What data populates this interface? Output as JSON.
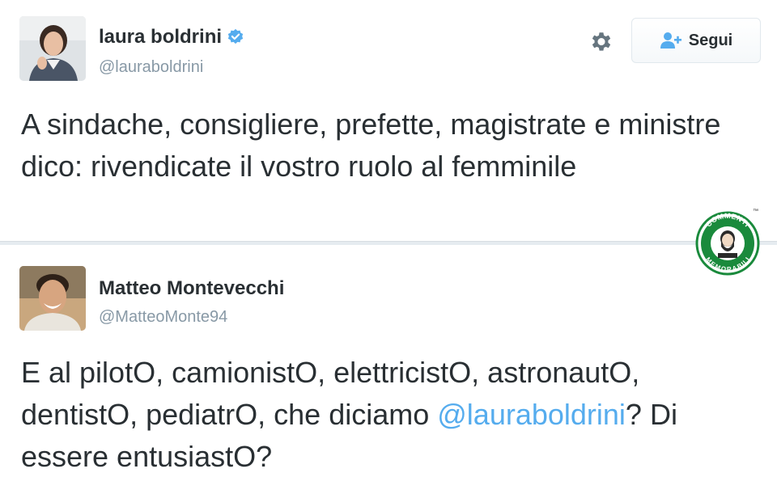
{
  "tweets": [
    {
      "fullname": "laura boldrini",
      "verified": true,
      "handle": "@lauraboldrini",
      "text": "A sindache, consigliere, prefette, magistrate e ministre dico: rivendicate il vostro ruolo al femminile",
      "follow_label": "Segui"
    },
    {
      "fullname": "Matteo Montevecchi",
      "handle": "@MatteoMonte94",
      "text_before": "E al pilotO, camionistO, elettricistO, astronautO, dentistO, pediatrO, che diciamo ",
      "mention": "@lauraboldrini",
      "text_after": "? Di essere entusiastO?"
    }
  ],
  "watermark": {
    "top_text": "COMMENTI",
    "bottom_text": "MEMORABILI",
    "tm": "™"
  },
  "colors": {
    "accent": "#55acee",
    "text": "#292f33",
    "muted": "#8899a6",
    "badge_green": "#1a8a3c"
  }
}
